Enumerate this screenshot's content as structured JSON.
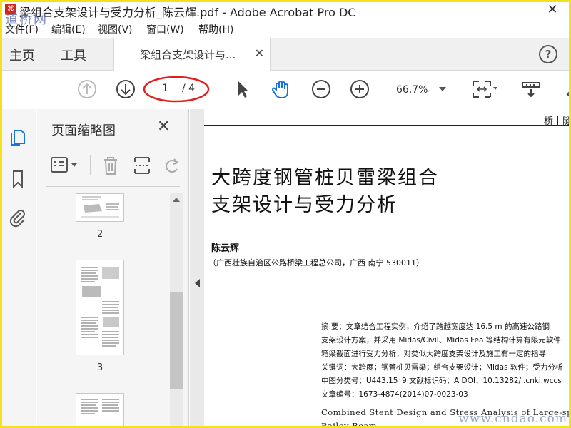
{
  "window": {
    "title": "梁组合支架设计与受力分析_陈云辉.pdf - Adobe Acrobat Pro DC",
    "watermark_top": "道桥网",
    "close_glyph": "✕"
  },
  "menu": [
    "文件(F)",
    "编辑(E)",
    "视图(V)",
    "窗口(W)",
    "帮助(H)"
  ],
  "nav": {
    "home": "主页",
    "tools": "工具"
  },
  "tab": {
    "label": "梁组合支架设计与...",
    "close": "✕"
  },
  "help": "?",
  "toolbar": {
    "page_current": "1",
    "page_total": "/ 4",
    "zoom": "66.7%",
    "annotation_color": "#e02020"
  },
  "thumbnails_panel": {
    "title": "页面缩略图",
    "close": "✕",
    "pages": [
      "2",
      "3"
    ]
  },
  "document": {
    "header_right": "桥丨隧",
    "title_line1": "大跨度钢管桩贝雷梁组合",
    "title_line2": "支架设计与受力分析",
    "author": "陈云辉",
    "affiliation": "（广西壮族自治区公路桥梁工程总公司，广西  南宁  530011）",
    "abstract_lines": [
      "摘    要：文章结合工程实例，介绍了跨越宽度达 16.5 m 的高速公路钢",
      "支架设计方案，并采用 Midas/Civil、Midas Fea 等结构计算有限元软件",
      "箱梁截面进行受力分析，对类似大跨度支架设计及施工有一定的指导",
      "关键词：大跨度；钢管桩贝雷梁；组合支架设计；Midas 软件；受力分析",
      "中图分类号：U443.15⁺9    文献标识码：A    DOI：10.13282/j.cnki.wccs",
      "文章编号：1673-4874(2014)07-0023-03"
    ],
    "english_title_line1": "Combined  Stent  Design  and  Stress  Analysis  of  Large-span",
    "english_title_line2": "Bailey Beam",
    "watermark_bottom": "www.cndao.com"
  }
}
